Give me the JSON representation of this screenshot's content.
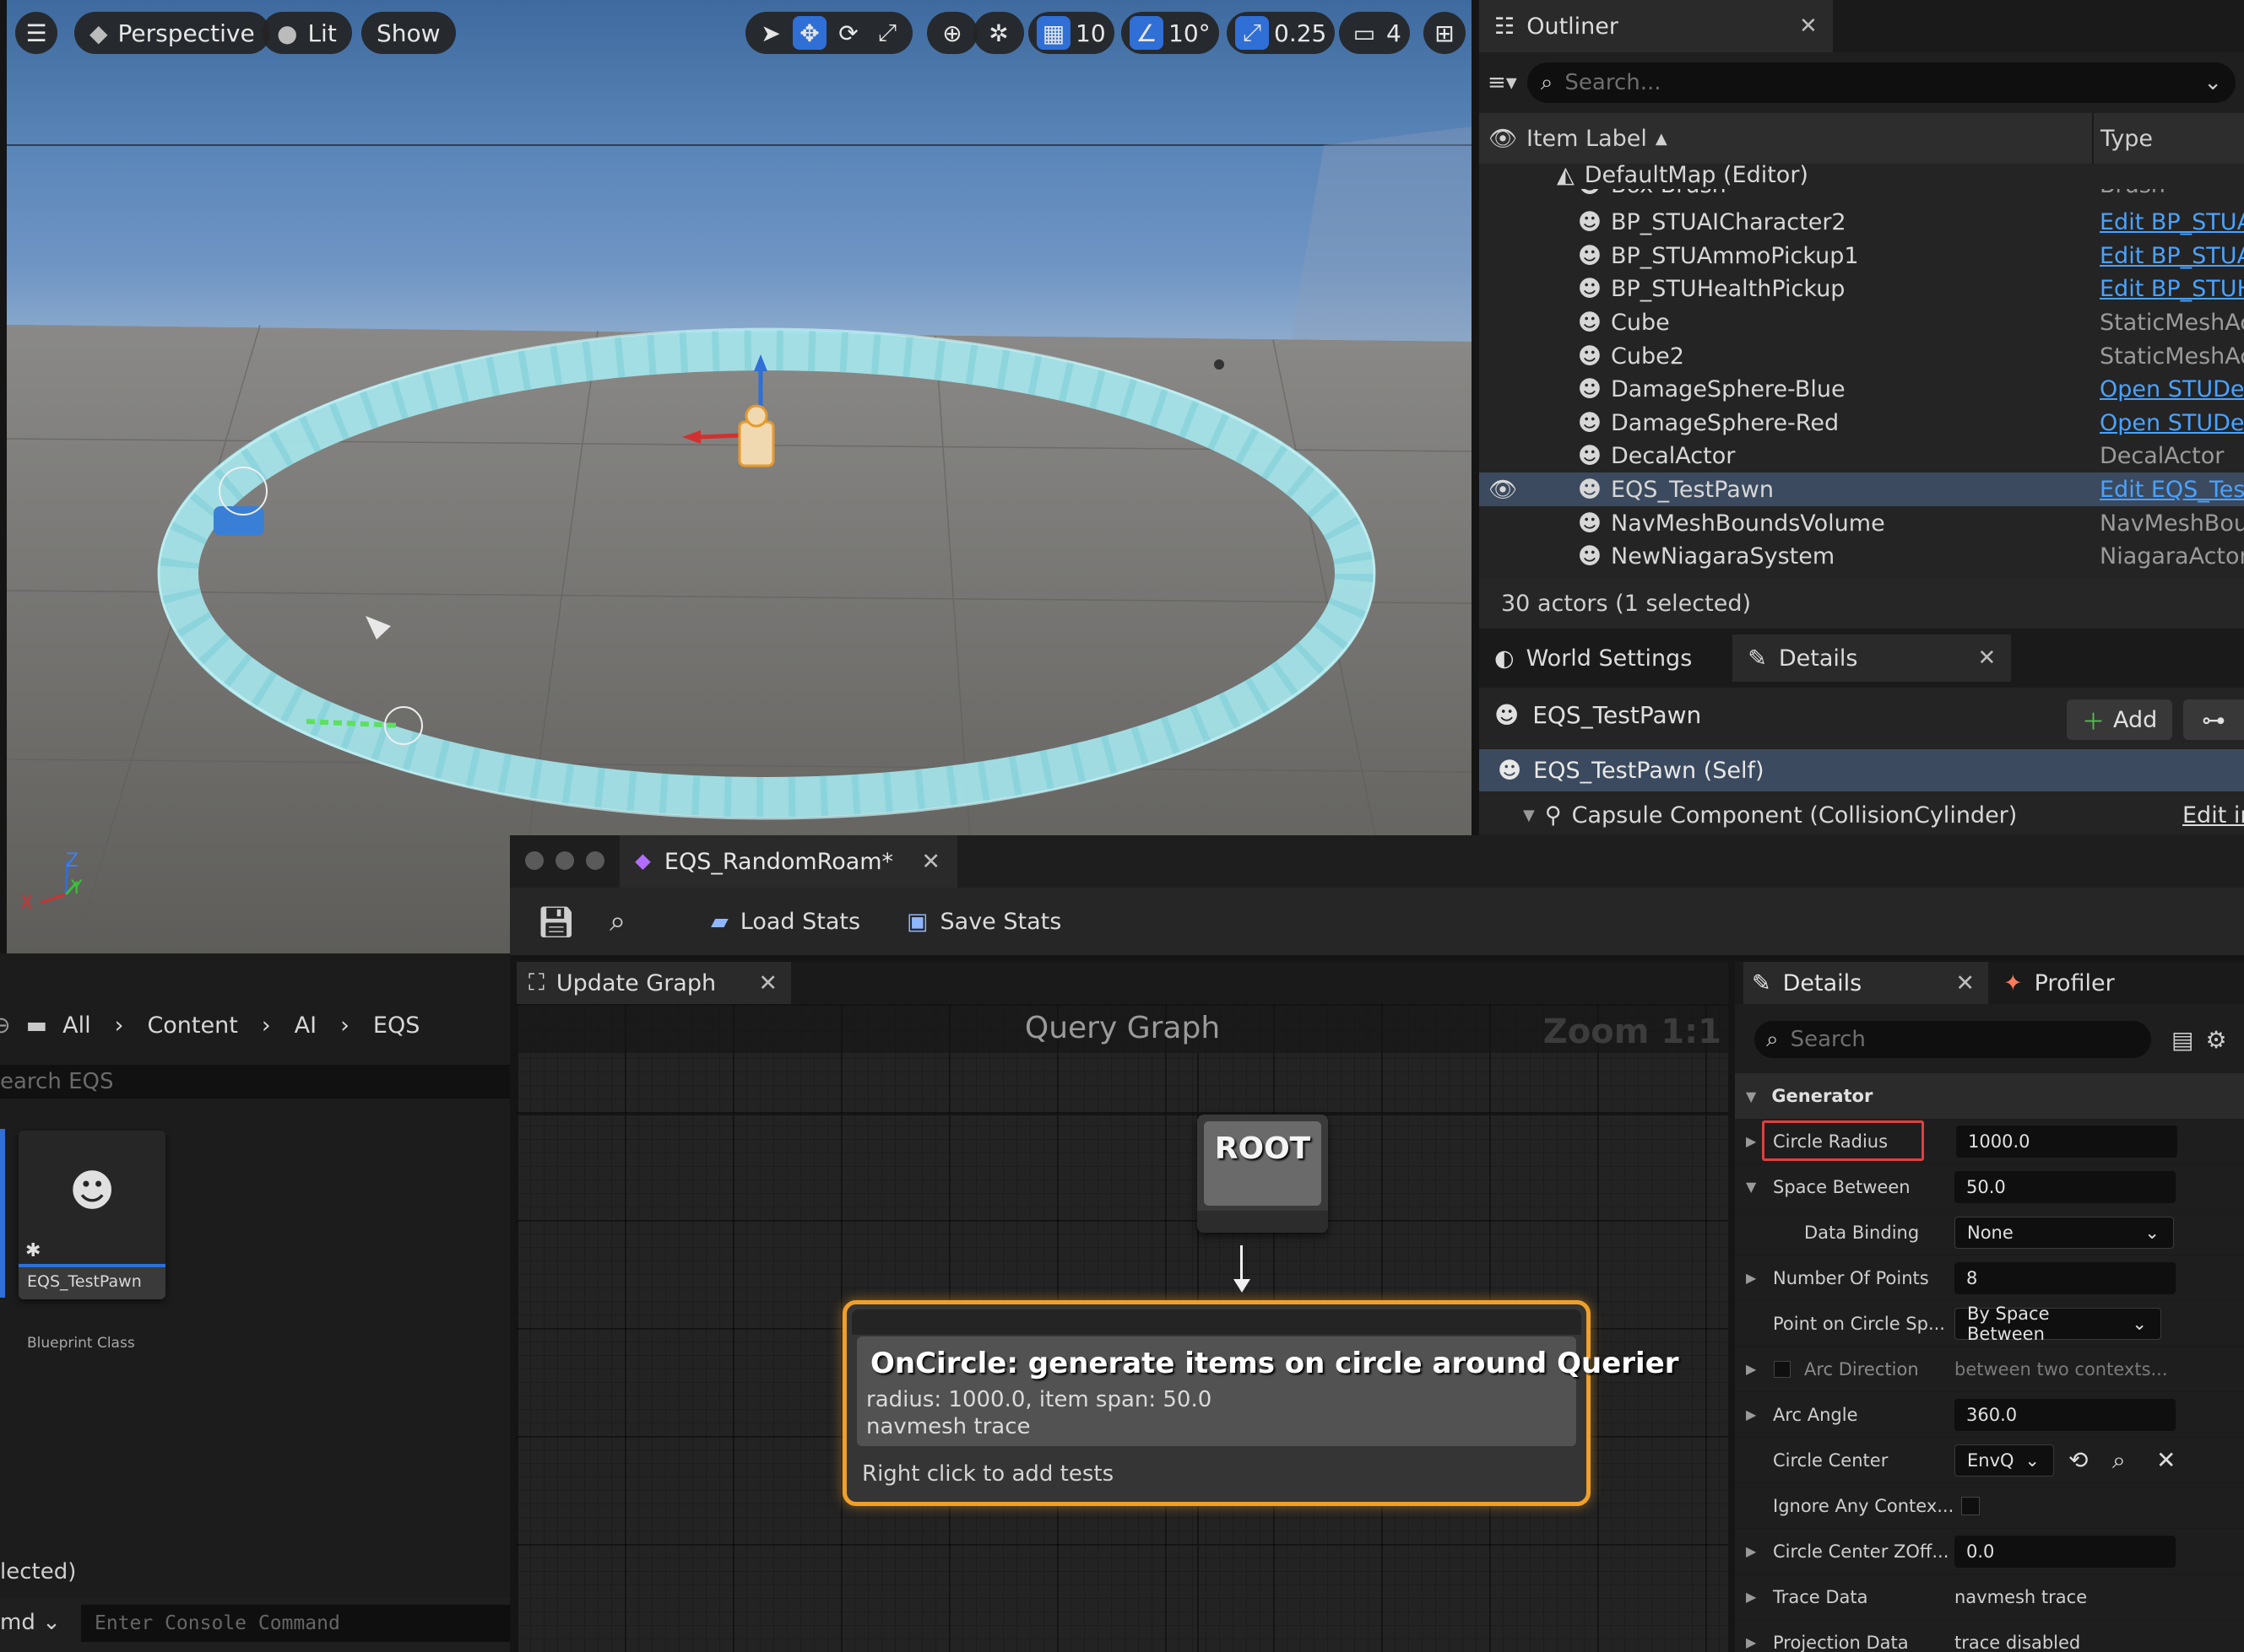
{
  "viewport": {
    "toolbar": {
      "perspective_label": "Perspective",
      "lit_label": "Lit",
      "show_label": "Show",
      "grid_snap": "10",
      "rotation_snap": "10°",
      "scale_snap": "0.25",
      "camera_speed": "4"
    },
    "axis": {
      "x": "X",
      "y": "Y",
      "z": "Z"
    }
  },
  "outliner": {
    "tab_title": "Outliner",
    "search_placeholder": "Search...",
    "col_item_label": "Item Label",
    "col_type": "Type",
    "root_label": "DefaultMap (Editor)",
    "items": [
      {
        "label": "Box Brush",
        "type": "Brush",
        "link": false
      },
      {
        "label": "BP_STUAICharacter2",
        "type": "Edit BP_STUA",
        "link": true
      },
      {
        "label": "BP_STUAmmoPickup1",
        "type": "Edit BP_STUA",
        "link": true
      },
      {
        "label": "BP_STUHealthPickup",
        "type": "Edit BP_STUH",
        "link": true
      },
      {
        "label": "Cube",
        "type": "StaticMeshAc",
        "link": false
      },
      {
        "label": "Cube2",
        "type": "StaticMeshAc",
        "link": false
      },
      {
        "label": "DamageSphere-Blue",
        "type": "Open STUDev",
        "link": true
      },
      {
        "label": "DamageSphere-Red",
        "type": "Open STUDev",
        "link": true
      },
      {
        "label": "DecalActor",
        "type": "DecalActor",
        "link": false
      },
      {
        "label": "EQS_TestPawn",
        "type": "Edit EQS_Test",
        "link": true
      },
      {
        "label": "NavMeshBoundsVolume",
        "type": "NavMeshBour",
        "link": false
      },
      {
        "label": "NewNiagaraSystem",
        "type": "NiagaraActor",
        "link": false
      }
    ],
    "status": "30 actors (1 selected)"
  },
  "details_top": {
    "tab_world_settings": "World Settings",
    "tab_details": "Details",
    "actor_name": "EQS_TestPawn",
    "add_label": "Add",
    "self_label": "EQS_TestPawn (Self)",
    "component_label": "Capsule Component (CollisionCylinder)",
    "component_link": "Edit in"
  },
  "eqs_window": {
    "tab_title": "EQS_RandomRoam*",
    "load_stats": "Load Stats",
    "save_stats": "Save Stats",
    "update_graph_tab": "Update Graph",
    "graph_title": "Query Graph",
    "zoom_label": "Zoom 1:1",
    "root_node": "ROOT",
    "node": {
      "title": "OnCircle: generate items on circle around Querier",
      "line1": "radius: 1000.0, item span: 50.0",
      "line2": "navmesh trace",
      "footer": "Right click to add tests"
    }
  },
  "content_browser": {
    "breadcrumb": [
      "All",
      "Content",
      "AI",
      "EQS"
    ],
    "search_placeholder": "earch EQS",
    "asset": {
      "name": "EQS_TestPawn",
      "type": "Blueprint Class"
    },
    "status": "lected)",
    "cmd_label": "md",
    "console_placeholder": "Enter Console Command"
  },
  "eqs_details": {
    "tab_details": "Details",
    "tab_profiler": "Profiler",
    "search_placeholder": "Search",
    "section": "Generator",
    "props": [
      {
        "name": "Circle Radius",
        "value": "1000.0",
        "kind": "input"
      },
      {
        "name": "Space Between",
        "value": "50.0",
        "kind": "input"
      },
      {
        "name": "Data Binding",
        "value": "None",
        "kind": "combo"
      },
      {
        "name": "Number Of Points",
        "value": "8",
        "kind": "input"
      },
      {
        "name": "Point on Circle Sp...",
        "value": "By Space Between",
        "kind": "combo"
      },
      {
        "name": "Arc Direction",
        "value": "between two contexts...",
        "kind": "plain"
      },
      {
        "name": "Arc Angle",
        "value": "360.0",
        "kind": "input"
      },
      {
        "name": "Circle Center",
        "value": "EnvQ",
        "kind": "combo"
      },
      {
        "name": "Ignore Any Contex...",
        "value": "",
        "kind": "check"
      },
      {
        "name": "Circle Center ZOff...",
        "value": "0.0",
        "kind": "input"
      },
      {
        "name": "Trace Data",
        "value": "navmesh trace",
        "kind": "plain"
      },
      {
        "name": "Projection Data",
        "value": "trace disabled",
        "kind": "plain"
      }
    ]
  },
  "colors": {
    "accent": "#2f6fd6",
    "link": "#4aa2ff",
    "node_border": "#f0a028",
    "ring": "#a6e8ee",
    "highlight_red": "#e04040"
  }
}
